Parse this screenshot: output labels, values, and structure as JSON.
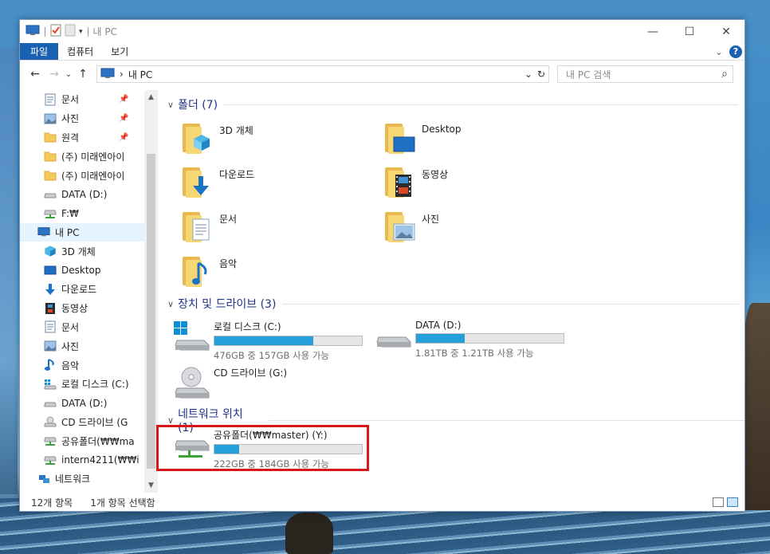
{
  "window": {
    "title": "내 PC",
    "controls": {
      "minimize": "—",
      "maximize": "☐",
      "close": "✕"
    }
  },
  "ribbon": {
    "tabs": [
      "파일",
      "컴퓨터",
      "보기"
    ],
    "collapse": "⌄",
    "help": "?"
  },
  "address": {
    "back": "←",
    "forward": "→",
    "recent": "⌄",
    "up": "↑",
    "sep": "›",
    "location": "내 PC",
    "dropdown": "⌄",
    "refresh": "↻",
    "search_placeholder": "내 PC 검색",
    "search_icon": "⌕"
  },
  "nav": {
    "items": [
      {
        "label": "문서",
        "icon": "document-icon",
        "pin": "📌"
      },
      {
        "label": "사진",
        "icon": "picture-icon",
        "pin": "📌"
      },
      {
        "label": "원격",
        "icon": "folder-icon",
        "pin": "📌"
      },
      {
        "label": "(주) 미래엔아이",
        "icon": "folder-icon"
      },
      {
        "label": "(주) 미래엔아이",
        "icon": "folder-icon"
      },
      {
        "label": "DATA (D:)",
        "icon": "drive-icon"
      },
      {
        "label": "F:₩",
        "icon": "network-drive-icon"
      },
      {
        "label": "내 PC",
        "icon": "pc-icon",
        "root": true,
        "selected": true
      },
      {
        "label": "3D 개체",
        "icon": "cube-icon"
      },
      {
        "label": "Desktop",
        "icon": "desktop-icon"
      },
      {
        "label": "다운로드",
        "icon": "download-icon"
      },
      {
        "label": "동영상",
        "icon": "video-icon"
      },
      {
        "label": "문서",
        "icon": "document-icon"
      },
      {
        "label": "사진",
        "icon": "picture-icon"
      },
      {
        "label": "음악",
        "icon": "music-icon"
      },
      {
        "label": "로컬 디스크 (C:)",
        "icon": "windows-drive-icon"
      },
      {
        "label": "DATA (D:)",
        "icon": "drive-icon"
      },
      {
        "label": "CD 드라이브 (G",
        "icon": "cd-drive-icon"
      },
      {
        "label": "공유폴더(₩₩ma",
        "icon": "network-drive-icon"
      },
      {
        "label": "intern4211(₩₩i",
        "icon": "network-drive-icon"
      },
      {
        "label": "네트워크",
        "icon": "network-icon",
        "root": true
      }
    ],
    "scroll_up": "▲",
    "scroll_down": "▼"
  },
  "groups": {
    "folders": {
      "chevron": "∨",
      "title": "폴더 (7)",
      "items": [
        {
          "label": "3D 개체",
          "icon": "cube-folder-icon"
        },
        {
          "label": "Desktop",
          "icon": "desktop-folder-icon"
        },
        {
          "label": "다운로드",
          "icon": "download-folder-icon"
        },
        {
          "label": "동영상",
          "icon": "video-folder-icon"
        },
        {
          "label": "문서",
          "icon": "document-folder-icon"
        },
        {
          "label": "사진",
          "icon": "picture-folder-icon"
        },
        {
          "label": "음악",
          "icon": "music-folder-icon"
        }
      ]
    },
    "devices": {
      "chevron": "∨",
      "title": "장치 및 드라이브 (3)",
      "items": [
        {
          "name": "로컬 디스크 (C:)",
          "free": "476GB 중 157GB 사용 가능",
          "used_fraction": 0.67,
          "icon": "windows-drive-icon"
        },
        {
          "name": "DATA (D:)",
          "free": "1.81TB 중 1.21TB 사용 가능",
          "used_fraction": 0.33,
          "icon": "drive-icon"
        },
        {
          "name": "CD 드라이브 (G:)",
          "icon": "cd-drive-icon"
        }
      ]
    },
    "network": {
      "chevron": "∨",
      "title": "네트워크 위치 (1)",
      "items": [
        {
          "name": "공유폴더(₩₩master) (Y:)",
          "free": "222GB 중 184GB 사용 가능",
          "used_fraction": 0.17,
          "icon": "network-drive-icon"
        }
      ]
    }
  },
  "status": {
    "count": "12개 항목",
    "selected": "1개 항목 선택함"
  },
  "colors": {
    "accent": "#1a61b3",
    "bar_fill": "#26a0da",
    "highlight": "#d71818",
    "group_title": "#1e3287"
  }
}
